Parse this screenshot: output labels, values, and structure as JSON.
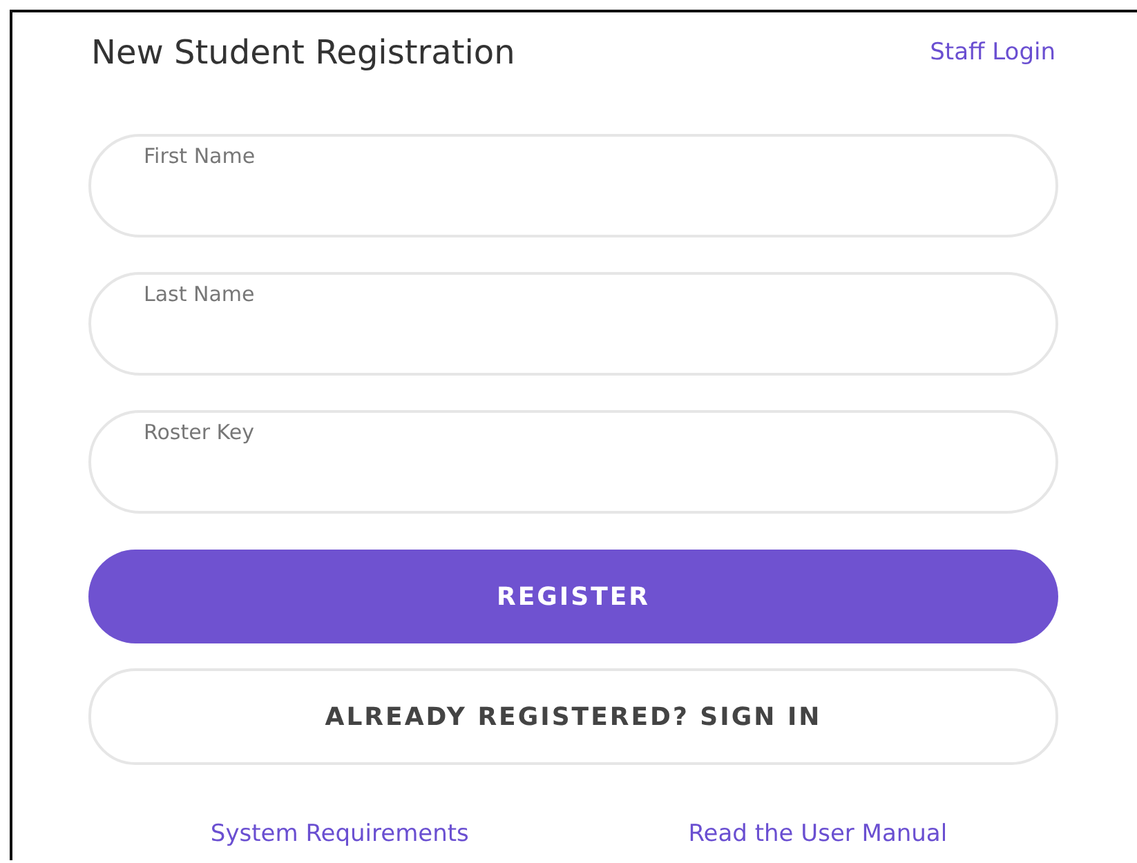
{
  "header": {
    "title": "New Student Registration",
    "staff_link": "Staff Login"
  },
  "fields": [
    {
      "placeholder": "First Name"
    },
    {
      "placeholder": "Last Name"
    },
    {
      "placeholder": "Roster Key"
    }
  ],
  "buttons": [
    {
      "label": "REGISTER",
      "kind": "primary"
    },
    {
      "label": "ALREADY REGISTERED? SIGN IN",
      "kind": "secondary"
    }
  ],
  "footer_links": [
    "System Requirements",
    "Read the User Manual"
  ]
}
